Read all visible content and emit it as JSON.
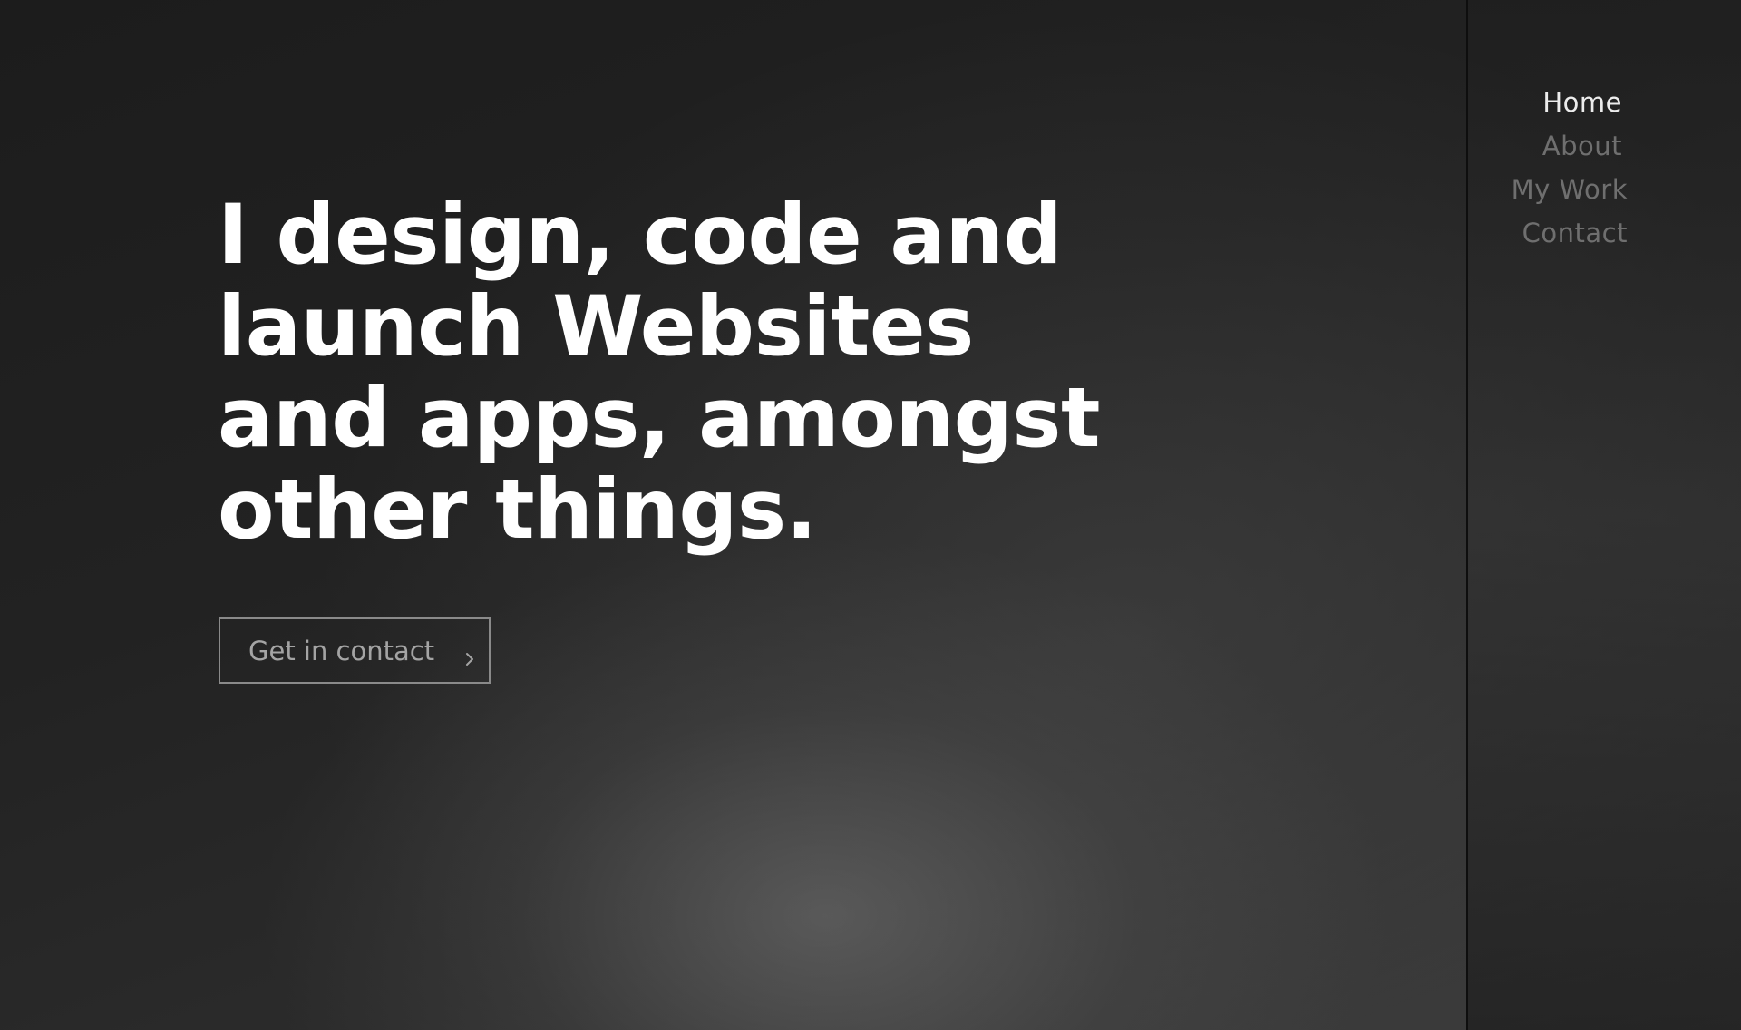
{
  "nav": {
    "items": [
      {
        "label": "Home",
        "active": true
      },
      {
        "label": "About",
        "active": false
      },
      {
        "label": "My Work",
        "active": false
      },
      {
        "label": "Contact",
        "active": false
      }
    ]
  },
  "hero": {
    "headline": "I design, code and launch Websites and apps, amongst other things.",
    "cta_label": "Get in contact",
    "cta_icon": "chevron-right-icon"
  },
  "colors": {
    "background": "#1f1f1f",
    "headline": "#ffffff",
    "nav_active": "#ececec",
    "nav_inactive": "#6f6f6f",
    "cta_text": "#a4a4a4",
    "cta_border": "#8a8a8a"
  }
}
